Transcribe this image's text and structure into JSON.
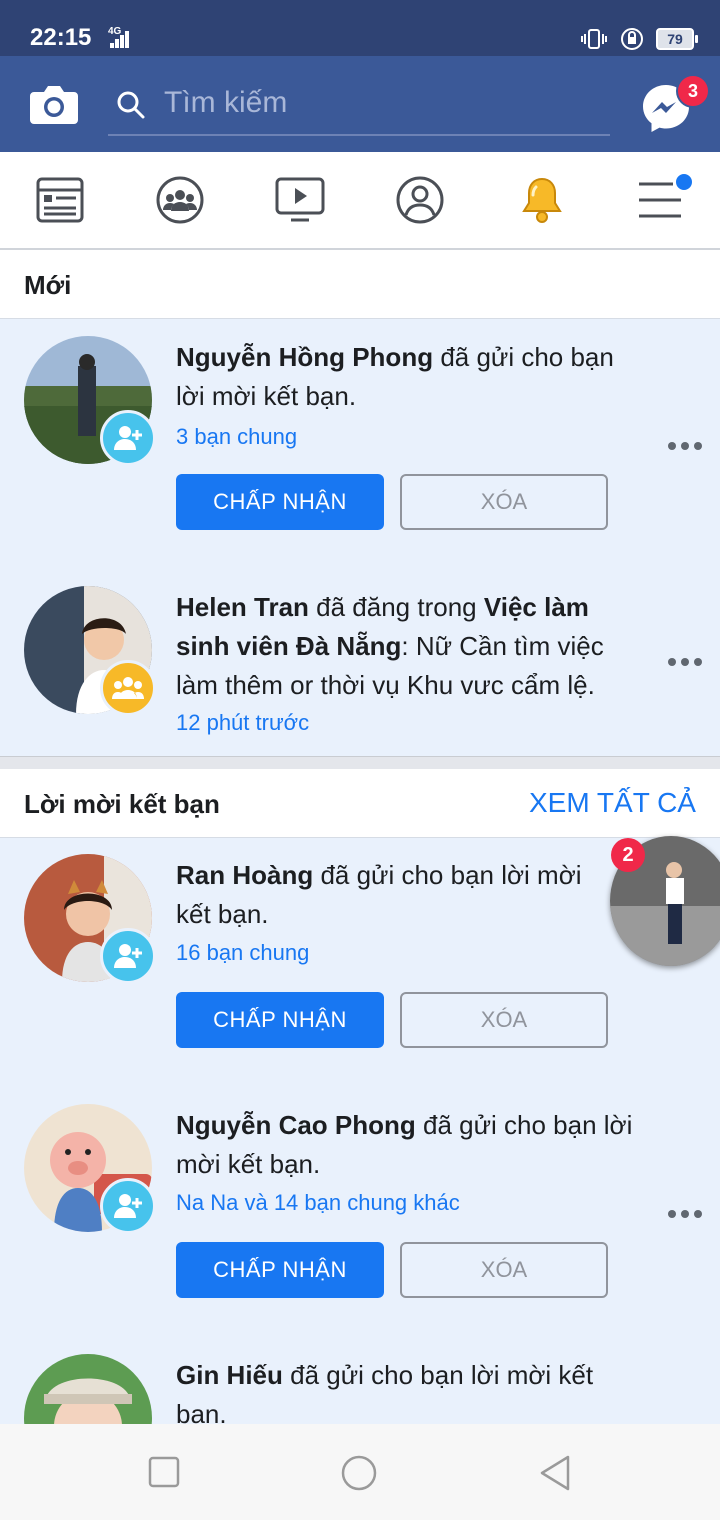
{
  "status_bar": {
    "time": "22:15",
    "network": "4G",
    "battery": "79"
  },
  "search": {
    "placeholder": "Tìm kiếm"
  },
  "messenger": {
    "badge": "3"
  },
  "sections": {
    "new": {
      "title": "Mới"
    },
    "friend_requests": {
      "title": "Lời mời kết bạn",
      "see_all": "XEM TẤT CẢ"
    }
  },
  "notifications": [
    {
      "name": "Nguyễn Hồng Phong",
      "text": " đã gửi cho bạn lời mời kết bạn.",
      "meta": "3 bạn chung",
      "type": "friend_request"
    },
    {
      "name": "Helen Tran",
      "text_a": " đã đăng trong ",
      "group": "Việc làm sinh viên Đà Nẵng",
      "text_b": ": Nữ Cần tìm việc làm thêm or thời vụ Khu vưc cẩm lệ.",
      "meta": "12 phút trước",
      "type": "group_post"
    }
  ],
  "requests": [
    {
      "name": "Ran Hoàng",
      "text": " đã gửi cho bạn lời mời kết bạn.",
      "meta": "16 bạn chung"
    },
    {
      "name": "Nguyễn Cao Phong",
      "text": " đã gửi cho bạn lời mời kết bạn.",
      "meta": "Na Na và 14 bạn chung khác"
    },
    {
      "name": "Gin Hiếu",
      "text": " đã gửi cho bạn lời mời kết bạn."
    }
  ],
  "buttons": {
    "accept": "CHẤP NHẬN",
    "delete": "XÓA"
  },
  "chat_head": {
    "badge": "2"
  },
  "colors": {
    "header": "#3b5998",
    "accent": "#1877f2",
    "badge": "#f02849",
    "unread_bg": "#e9f1fc"
  },
  "icons": [
    "camera-icon",
    "search-icon",
    "messenger-icon",
    "news-feed-icon",
    "groups-icon",
    "watch-icon",
    "profile-icon",
    "bell-icon",
    "menu-icon",
    "add-friend-icon",
    "group-icon",
    "more-icon"
  ]
}
